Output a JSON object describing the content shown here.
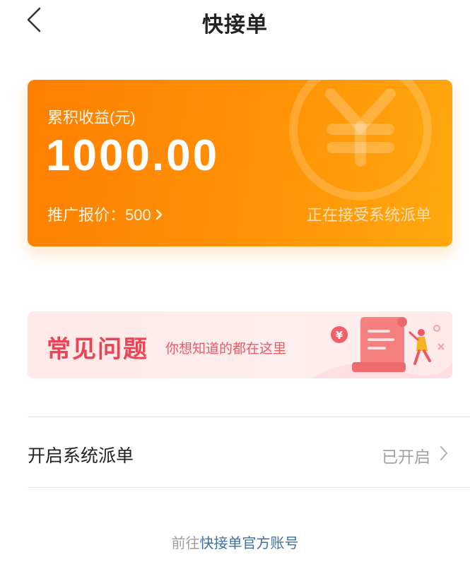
{
  "nav": {
    "title": "快接单"
  },
  "earnings": {
    "label": "累积收益(元)",
    "amount": "1000.00",
    "promo_label": "推广报价：",
    "promo_value": "500",
    "status": "正在接受系统派单"
  },
  "faq": {
    "title": "常见问题",
    "subtitle": "你想知道的都在这里",
    "art_symbol": "¥"
  },
  "dispatch": {
    "label": "开启系统派单",
    "value": "已开启"
  },
  "footer": {
    "prefix": "前往",
    "link": "快接单官方账号"
  },
  "colors": {
    "card_start": "#ff7f00",
    "card_end": "#ffa80f",
    "faq_title": "#ea4455",
    "link": "#3e6fa0"
  }
}
